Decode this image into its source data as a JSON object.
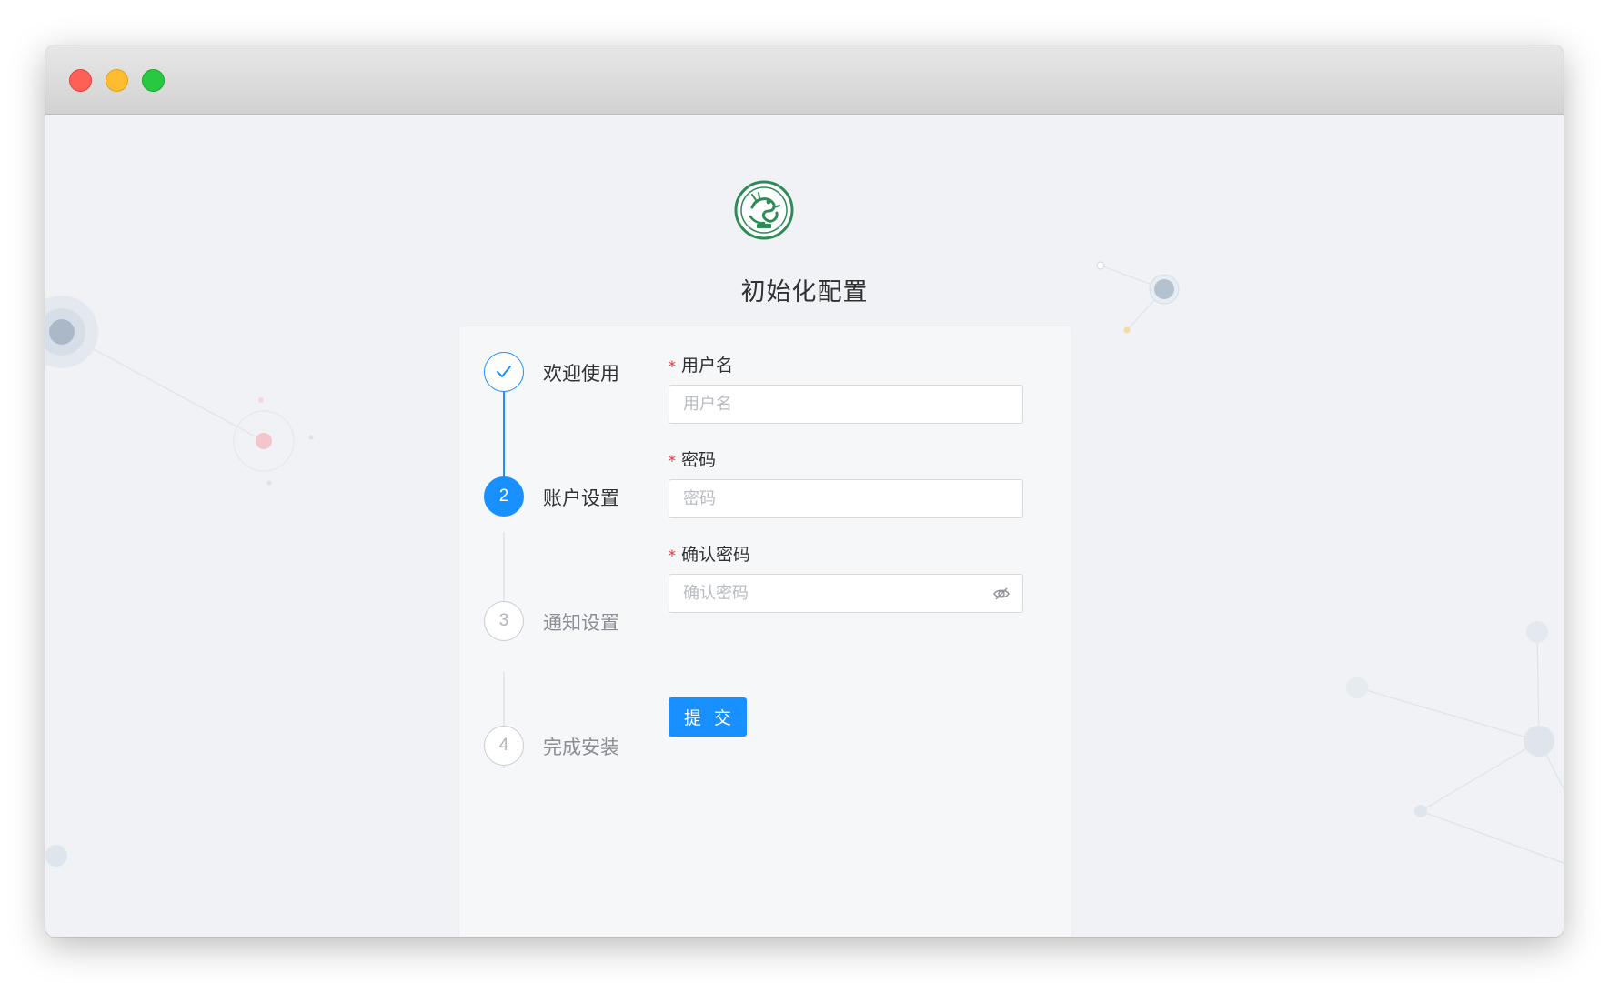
{
  "window": {
    "traffic_lights": [
      "close",
      "minimize",
      "zoom"
    ]
  },
  "page": {
    "title": "初始化配置",
    "logo_icon": "green-dragon-seal-logo"
  },
  "steps": [
    {
      "number": "1",
      "label": "欢迎使用",
      "status": "finished",
      "icon": "check-icon"
    },
    {
      "number": "2",
      "label": "账户设置",
      "status": "active"
    },
    {
      "number": "3",
      "label": "通知设置",
      "status": "waiting"
    },
    {
      "number": "4",
      "label": "完成安装",
      "status": "waiting"
    }
  ],
  "form": {
    "required_mark": "*",
    "username": {
      "label": "用户名",
      "placeholder": "用户名",
      "value": ""
    },
    "password": {
      "label": "密码",
      "placeholder": "密码",
      "value": ""
    },
    "confirm_password": {
      "label": "确认密码",
      "placeholder": "确认密码",
      "value": "",
      "icon": "eye-off-icon"
    },
    "submit_label": "提 交"
  },
  "colors": {
    "primary": "#1890ff",
    "required": "#f5222d",
    "background": "#f0f2f5",
    "logo_green": "#2e8b57"
  }
}
